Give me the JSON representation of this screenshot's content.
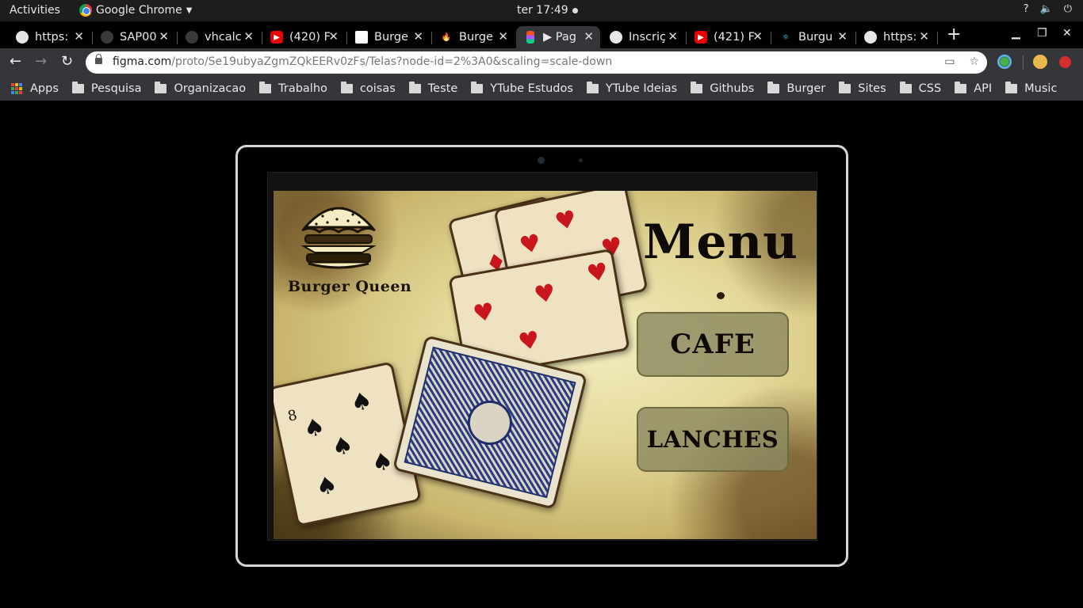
{
  "system_bar": {
    "activities": "Activities",
    "app_name": "Google Chrome",
    "clock": "ter 17:49",
    "tray": [
      "?",
      "🔈",
      "⏻"
    ]
  },
  "tabs": [
    {
      "label": "https:",
      "icon": "globe-icon"
    },
    {
      "label": "SAP00",
      "icon": "github-icon"
    },
    {
      "label": "vhcalc",
      "icon": "github-icon"
    },
    {
      "label": "(420) F",
      "icon": "youtube-icon"
    },
    {
      "label": "Burge",
      "icon": "trello-icon"
    },
    {
      "label": "Burge",
      "icon": "firebase-icon"
    },
    {
      "label": "▶ Pag",
      "icon": "figma-icon",
      "active": true
    },
    {
      "label": "Inscriç",
      "icon": "globe-icon"
    },
    {
      "label": "(421) F",
      "icon": "youtube-icon"
    },
    {
      "label": "Burgu",
      "icon": "react-icon"
    },
    {
      "label": "https:",
      "icon": "globe-icon"
    }
  ],
  "toolbar": {
    "url_host": "figma.com",
    "url_path": "/proto/Se19ubyaZgmZQkEERv0zFs/Telas?node-id=2%3A0&scaling=scale-down"
  },
  "bookmarks": [
    "Apps",
    "Pesquisa",
    "Organizacao",
    "Trabalho",
    "coisas",
    "Teste",
    "YTube Estudos",
    "YTube Ideias",
    "Githubs",
    "Burger",
    "Sites",
    "CSS",
    "API",
    "Music"
  ],
  "app": {
    "brand": "Burger Queen",
    "title": "Menu",
    "buttons": {
      "cafe": "CAFE",
      "lanches": "LANCHES"
    }
  },
  "colors": {
    "button_bg": "#8c8a62",
    "title_text": "#0d0a05",
    "card_red": "#c8161c",
    "card_back_blue": "#2a3c85"
  }
}
